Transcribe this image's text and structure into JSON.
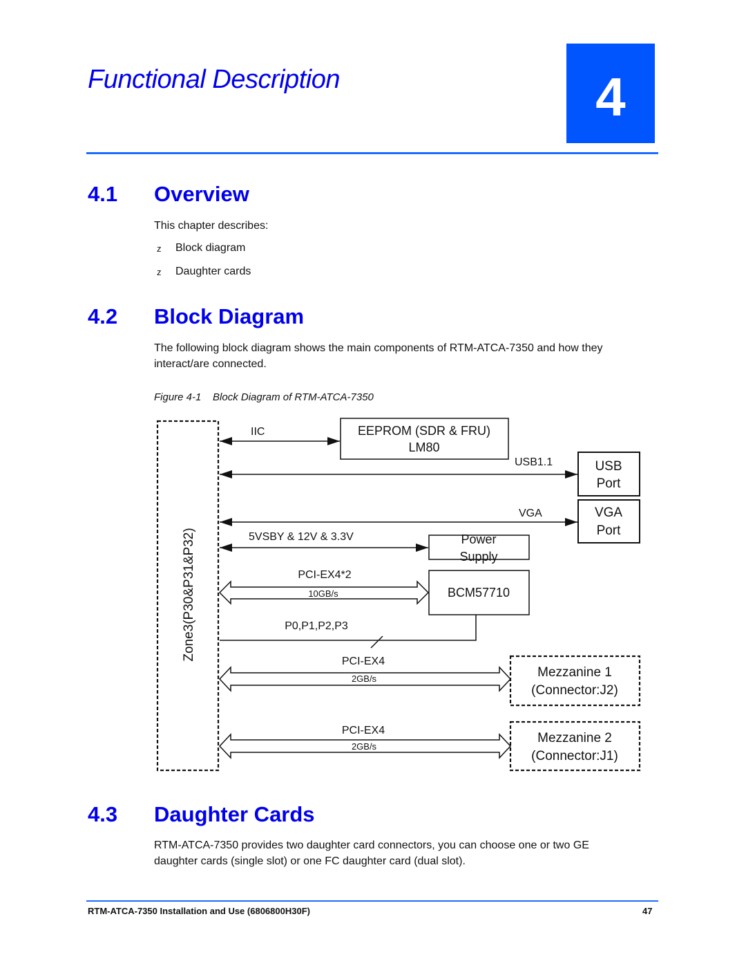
{
  "chapter": {
    "title": "Functional Description",
    "number": "4",
    "accent_color": "#0055ff"
  },
  "sections": [
    {
      "number": "4.1",
      "title": "Overview",
      "intro": "This chapter describes:",
      "bullet_glyph": "z",
      "bullets": [
        "Block diagram",
        "Daughter cards"
      ]
    },
    {
      "number": "4.2",
      "title": "Block Diagram",
      "paragraph_line1": "The following block diagram shows the main components of RTM-ATCA-7350 and how they",
      "paragraph_line2": "interact/are connected.",
      "figure_caption": "Figure 4-1    Block Diagram of RTM-ATCA-7350"
    },
    {
      "number": "4.3",
      "title": "Daughter Cards",
      "paragraph_line1": "RTM-ATCA-7350 provides two daughter card connectors, you can choose one or two GE",
      "paragraph_line2": "daughter cards (single slot) or one FC daughter card (dual slot)."
    }
  ],
  "diagram": {
    "zone_label": "Zone3(P30&P31&P32)",
    "blocks": {
      "eeprom_line1": "EEPROM (SDR & FRU)",
      "eeprom_line2": "LM80",
      "usb_line1": "USB",
      "usb_line2": "Port",
      "vga_line1": "VGA",
      "vga_line2": "Port",
      "power_line1": "Power",
      "power_line2": "Supply",
      "bcm": "BCM57710",
      "mezz1_line1": "Mezzanine 1",
      "mezz1_line2": "(Connector:J2)",
      "mezz2_line1": "Mezzanine 2",
      "mezz2_line2": "(Connector:J1)"
    },
    "links": {
      "iic": "IIC",
      "usb": "USB1.1",
      "vga": "VGA",
      "power": "5VSBY & 12V & 3.3V",
      "pcie_bcm": "PCI-EX4*2",
      "pcie_bcm_rate": "10GB/s",
      "ports": "P0,P1,P2,P3",
      "pcie_mezz1": "PCI-EX4",
      "pcie_mezz1_rate": "2GB/s",
      "pcie_mezz2": "PCI-EX4",
      "pcie_mezz2_rate": "2GB/s"
    }
  },
  "footer": {
    "doc_title": "RTM-ATCA-7350 Installation and Use (6806800H30F)",
    "page_number": "47"
  }
}
